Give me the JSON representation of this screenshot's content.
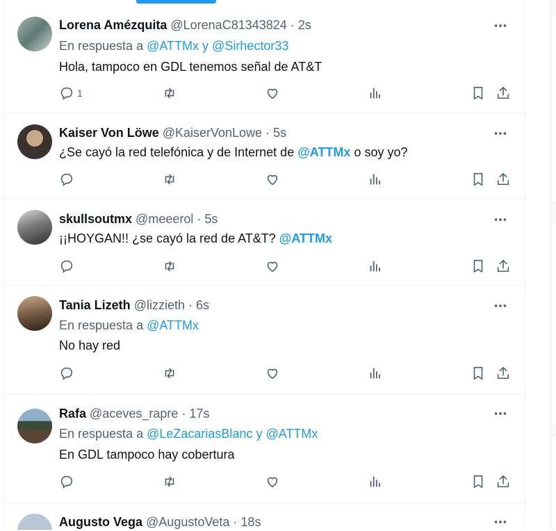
{
  "colors": {
    "accent": "#1d9bf0",
    "secondary": "#536471",
    "primary": "#0f1419"
  },
  "tweets": [
    {
      "name": "Lorena Amézquita",
      "handle": "@LorenaC81343824",
      "time": "2s",
      "reply_prefix": "En respuesta a",
      "reply_mentions": [
        "@ATTMx",
        "@Sirhector33"
      ],
      "reply_joiner": "y",
      "text_parts": [
        "Hola, tampoco en GDL tenemos señal de AT&T"
      ],
      "reply_count": "1",
      "avatar": "avatar-photo"
    },
    {
      "name": "Kaiser Von Löwe",
      "handle": "@KaiserVonLowe",
      "time": "5s",
      "text_parts": [
        "¿Se cayó la red telefónica y de Internet de ",
        "@ATTMx",
        " o soy yo?"
      ],
      "reply_count": "",
      "avatar": "avatar-photo"
    },
    {
      "name": "skullsoutmx",
      "handle": "@meeerol",
      "time": "5s",
      "text_parts": [
        "¡¡HOYGAN!! ¿se cayó la red de AT&T? ",
        "@ATTMx"
      ],
      "reply_count": "",
      "avatar": "avatar-photo"
    },
    {
      "name": "Tania Lizeth",
      "handle": "@lizzieth",
      "time": "6s",
      "reply_prefix": "En respuesta a",
      "reply_mentions": [
        "@ATTMx"
      ],
      "text_parts": [
        "No hay red"
      ],
      "reply_count": "",
      "avatar": "avatar-photo"
    },
    {
      "name": "Rafa",
      "handle": "@aceves_rapre",
      "time": "17s",
      "reply_prefix": "En respuesta a",
      "reply_mentions": [
        "@LeZacariasBlanc",
        "@ATTMx"
      ],
      "reply_joiner": "y",
      "text_parts": [
        "En GDL tampoco hay cobertura"
      ],
      "reply_count": "",
      "avatar": "avatar-photo"
    },
    {
      "name": "Augusto Vega",
      "handle": "@AugustoVeta",
      "time": "18s",
      "avatar": "avatar-photo"
    }
  ],
  "separator": "·",
  "icons": [
    "more-icon",
    "reply-icon",
    "retweet-icon",
    "like-icon",
    "views-icon",
    "bookmark-icon",
    "share-icon"
  ]
}
